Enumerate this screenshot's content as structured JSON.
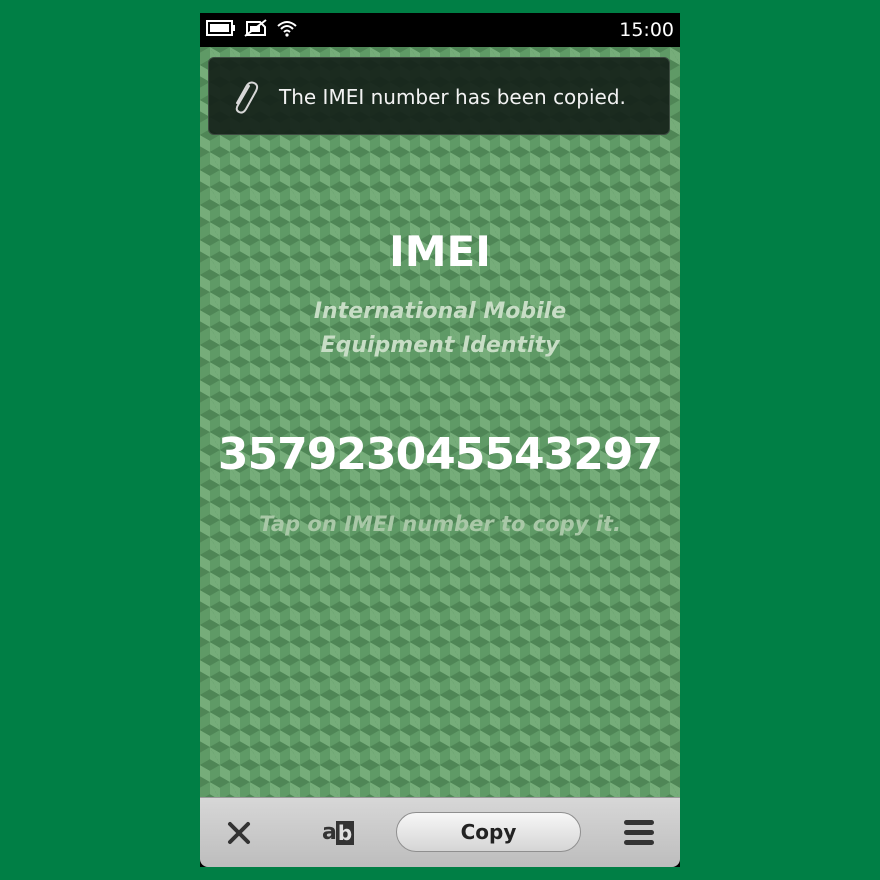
{
  "status_bar": {
    "time": "15:00",
    "icons": [
      "battery-icon",
      "no-sim-icon",
      "wifi-icon"
    ]
  },
  "notification": {
    "icon": "paperclip-icon",
    "text": "The IMEI number has been copied."
  },
  "main": {
    "title": "IMEI",
    "subtitle_line1": "International Mobile",
    "subtitle_line2": "Equipment Identity",
    "imei_number": "357923045543297",
    "hint": "Tap on IMEI number to copy it."
  },
  "toolbar": {
    "close_icon": "close-icon",
    "text_format_icon": "text-format-icon",
    "ab_a": "a",
    "ab_b": "b",
    "copy_label": "Copy",
    "menu_icon": "menu-icon"
  },
  "colors": {
    "background": "#007f45",
    "content_green": "#5f9a66",
    "toolbar_gray": "#c9c9c9"
  }
}
